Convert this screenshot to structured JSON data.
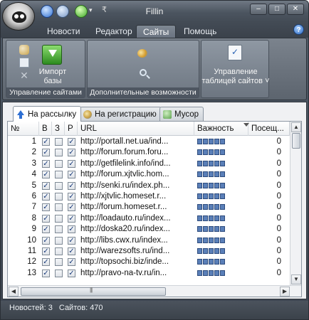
{
  "window": {
    "title": "Fillin",
    "controls": [
      "–",
      "□",
      "✕"
    ]
  },
  "menu_tabs": [
    {
      "label": "Новости",
      "active": false
    },
    {
      "label": "Редактор",
      "active": false
    },
    {
      "label": "Сайты",
      "active": true
    },
    {
      "label": "Помощь",
      "active": false
    }
  ],
  "ribbon": {
    "group_manage": {
      "label": "Управление сайтами",
      "import_label_line1": "Импорт",
      "import_label_line2": "базы"
    },
    "group_extra": {
      "label": "Дополнительные возможности"
    },
    "group_table": {
      "button_line1": "Управление",
      "button_line2": "таблицей сайтов ˅"
    }
  },
  "content_tabs": [
    {
      "label": "На рассылку",
      "active": true,
      "icon": "upload-arrow-icon"
    },
    {
      "label": "На регистрацию",
      "active": false,
      "icon": "register-icon"
    },
    {
      "label": "Мусор",
      "active": false,
      "icon": "trash-icon"
    }
  ],
  "table": {
    "headers": {
      "num": "№",
      "b": "В",
      "z": "З",
      "r": "Р",
      "url": "URL",
      "importance": "Важность",
      "visits": "Посещ..."
    },
    "rows": [
      {
        "num": "1",
        "b": true,
        "z": false,
        "r": true,
        "url": "http://portall.net.ua/ind...",
        "visits": "0"
      },
      {
        "num": "2",
        "b": true,
        "z": false,
        "r": true,
        "url": "http://forum.forum.foru...",
        "visits": "0"
      },
      {
        "num": "3",
        "b": true,
        "z": false,
        "r": true,
        "url": "http://getfilelink.info/ind...",
        "visits": "0"
      },
      {
        "num": "4",
        "b": true,
        "z": false,
        "r": true,
        "url": "http://forum.xjtvlic.hom...",
        "visits": "0"
      },
      {
        "num": "5",
        "b": true,
        "z": false,
        "r": true,
        "url": "http://senki.ru/index.ph...",
        "visits": "0"
      },
      {
        "num": "6",
        "b": true,
        "z": false,
        "r": true,
        "url": "http://xjtvlic.homeset.r...",
        "visits": "0"
      },
      {
        "num": "7",
        "b": true,
        "z": false,
        "r": true,
        "url": "http://forum.homeset.r...",
        "visits": "0"
      },
      {
        "num": "8",
        "b": true,
        "z": false,
        "r": true,
        "url": "http://loadauto.ru/index...",
        "visits": "0"
      },
      {
        "num": "9",
        "b": true,
        "z": false,
        "r": true,
        "url": "http://doska20.ru/index...",
        "visits": "0"
      },
      {
        "num": "10",
        "b": true,
        "z": false,
        "r": true,
        "url": "http://libs.cwx.ru/index...",
        "visits": "0"
      },
      {
        "num": "11",
        "b": true,
        "z": false,
        "r": true,
        "url": "http://warezsofts.ru/ind...",
        "visits": "0"
      },
      {
        "num": "12",
        "b": true,
        "z": false,
        "r": true,
        "url": "http://topsochi.biz/inde...",
        "visits": "0"
      },
      {
        "num": "13",
        "b": true,
        "z": false,
        "r": true,
        "url": "http://pravo-na-tv.ru/in...",
        "visits": "0"
      }
    ]
  },
  "status": {
    "news": "Новостей: 3",
    "sites": "Сайтов: 470"
  }
}
